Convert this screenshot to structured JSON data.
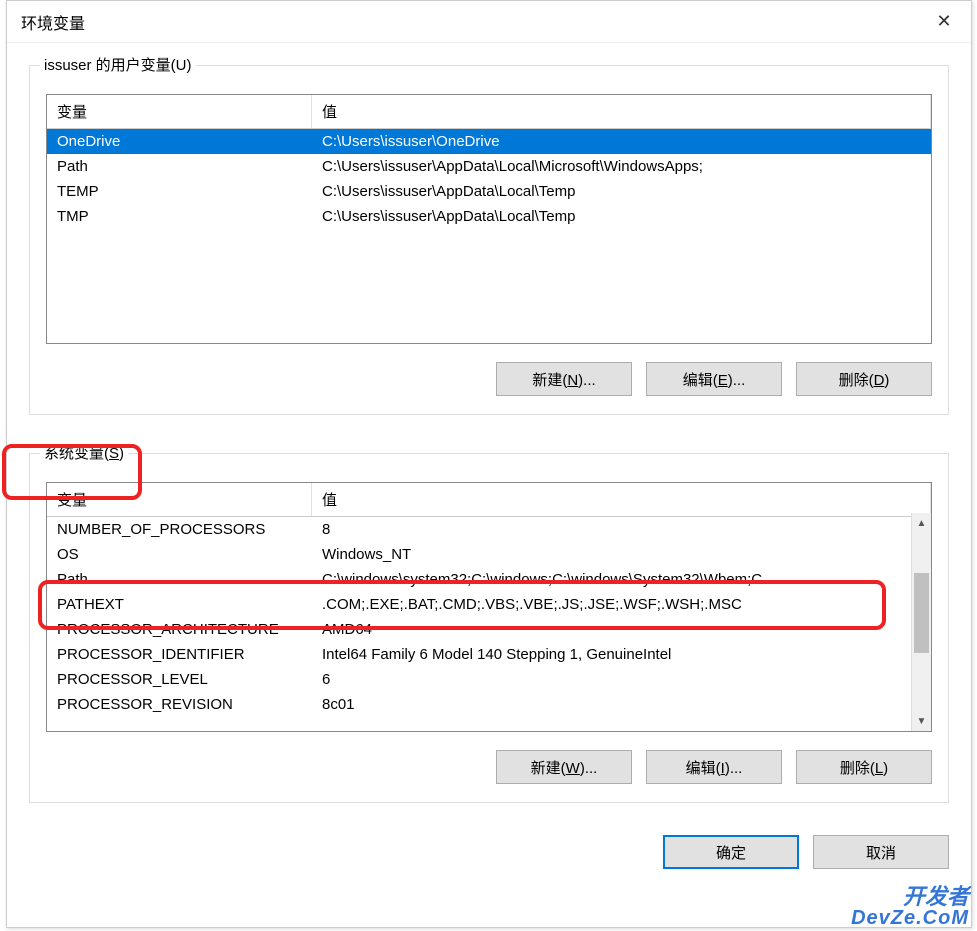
{
  "dialog": {
    "title": "环境变量",
    "close_icon": "✕"
  },
  "user_vars": {
    "label": "issuser 的用户变量(U)",
    "headers": {
      "variable": "变量",
      "value": "值"
    },
    "rows": [
      {
        "var": "OneDrive",
        "val": "C:\\Users\\issuser\\OneDrive",
        "selected": true
      },
      {
        "var": "Path",
        "val": "C:\\Users\\issuser\\AppData\\Local\\Microsoft\\WindowsApps;",
        "selected": false
      },
      {
        "var": "TEMP",
        "val": "C:\\Users\\issuser\\AppData\\Local\\Temp",
        "selected": false
      },
      {
        "var": "TMP",
        "val": "C:\\Users\\issuser\\AppData\\Local\\Temp",
        "selected": false
      }
    ],
    "btn_new": "新建(N)...",
    "btn_edit": "编辑(E)...",
    "btn_delete": "删除(D)"
  },
  "sys_vars": {
    "label": "系统变量(S)",
    "headers": {
      "variable": "变量",
      "value": "值"
    },
    "rows": [
      {
        "var": "NUMBER_OF_PROCESSORS",
        "val": "8"
      },
      {
        "var": "OS",
        "val": "Windows_NT"
      },
      {
        "var": "Path",
        "val": "C:\\windows\\system32;C:\\windows;C:\\windows\\System32\\Wbem;C..."
      },
      {
        "var": "PATHEXT",
        "val": ".COM;.EXE;.BAT;.CMD;.VBS;.VBE;.JS;.JSE;.WSF;.WSH;.MSC"
      },
      {
        "var": "PROCESSOR_ARCHITECTURE",
        "val": "AMD64"
      },
      {
        "var": "PROCESSOR_IDENTIFIER",
        "val": "Intel64 Family 6 Model 140 Stepping 1, GenuineIntel"
      },
      {
        "var": "PROCESSOR_LEVEL",
        "val": "6"
      },
      {
        "var": "PROCESSOR_REVISION",
        "val": "8c01"
      }
    ],
    "btn_new": "新建(W)...",
    "btn_edit": "编辑(I)...",
    "btn_delete": "删除(L)"
  },
  "main_buttons": {
    "ok": "确定",
    "cancel": "取消"
  },
  "watermark": {
    "line1": "开发者",
    "line2": "DevZe.CoM"
  }
}
